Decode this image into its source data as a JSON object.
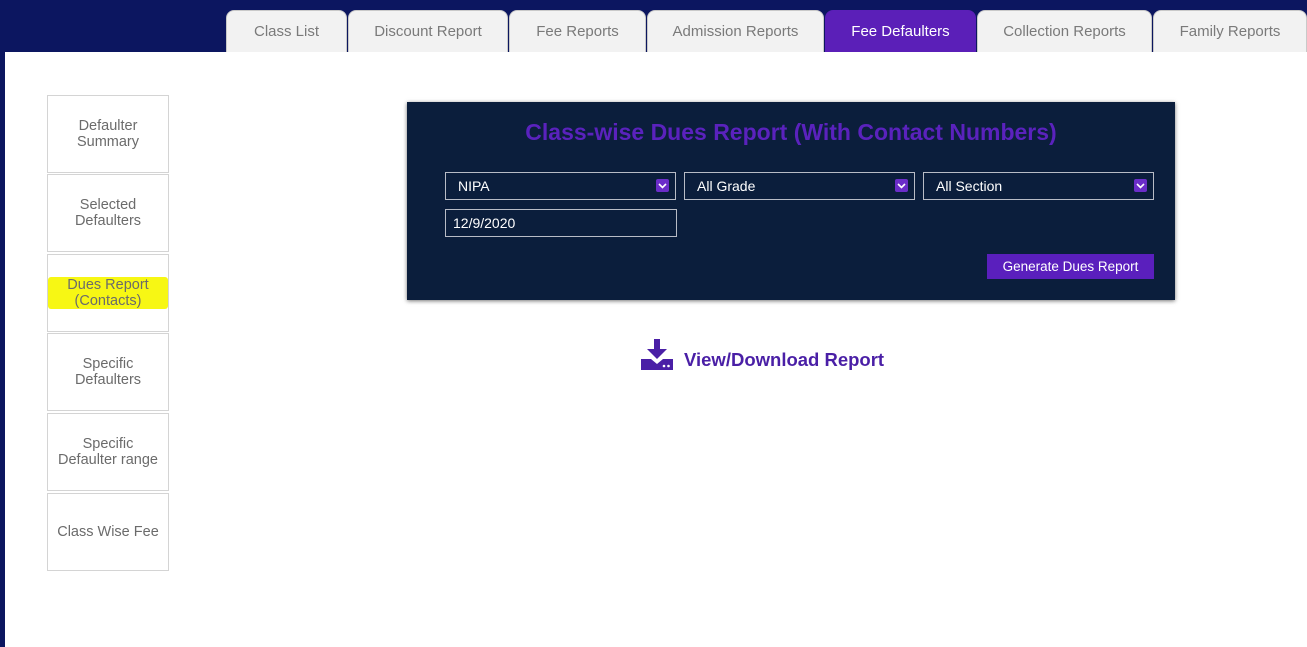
{
  "tabs": [
    {
      "label": "Class List",
      "active": false
    },
    {
      "label": "Discount Report",
      "active": false
    },
    {
      "label": "Fee Reports",
      "active": false
    },
    {
      "label": "Admission Reports",
      "active": false
    },
    {
      "label": "Fee Defaulters",
      "active": true
    },
    {
      "label": "Collection Reports",
      "active": false
    },
    {
      "label": "Family Reports",
      "active": false
    }
  ],
  "sidebar": {
    "items": [
      {
        "label": "Defaulter Summary"
      },
      {
        "label": "Selected Defaulters"
      },
      {
        "label": "Dues Report (Contacts)",
        "highlighted": true
      },
      {
        "label": "Specific Defaulters"
      },
      {
        "label": "Specific Defaulter range"
      },
      {
        "label": "Class Wise Fee"
      }
    ]
  },
  "panel": {
    "title": "Class-wise Dues Report (With Contact Numbers)",
    "campus_select": "NIPA",
    "grade_select": "All Grade",
    "section_select": "All Section",
    "date_value": "12/9/2020",
    "generate_button": "Generate Dues Report"
  },
  "download": {
    "label": "View/Download Report",
    "icon": "download-icon"
  },
  "colors": {
    "brand_navy": "#0c1660",
    "panel_bg": "#0b1e3c",
    "accent_purple": "#5a1fbd",
    "highlight": "#f7f714"
  }
}
